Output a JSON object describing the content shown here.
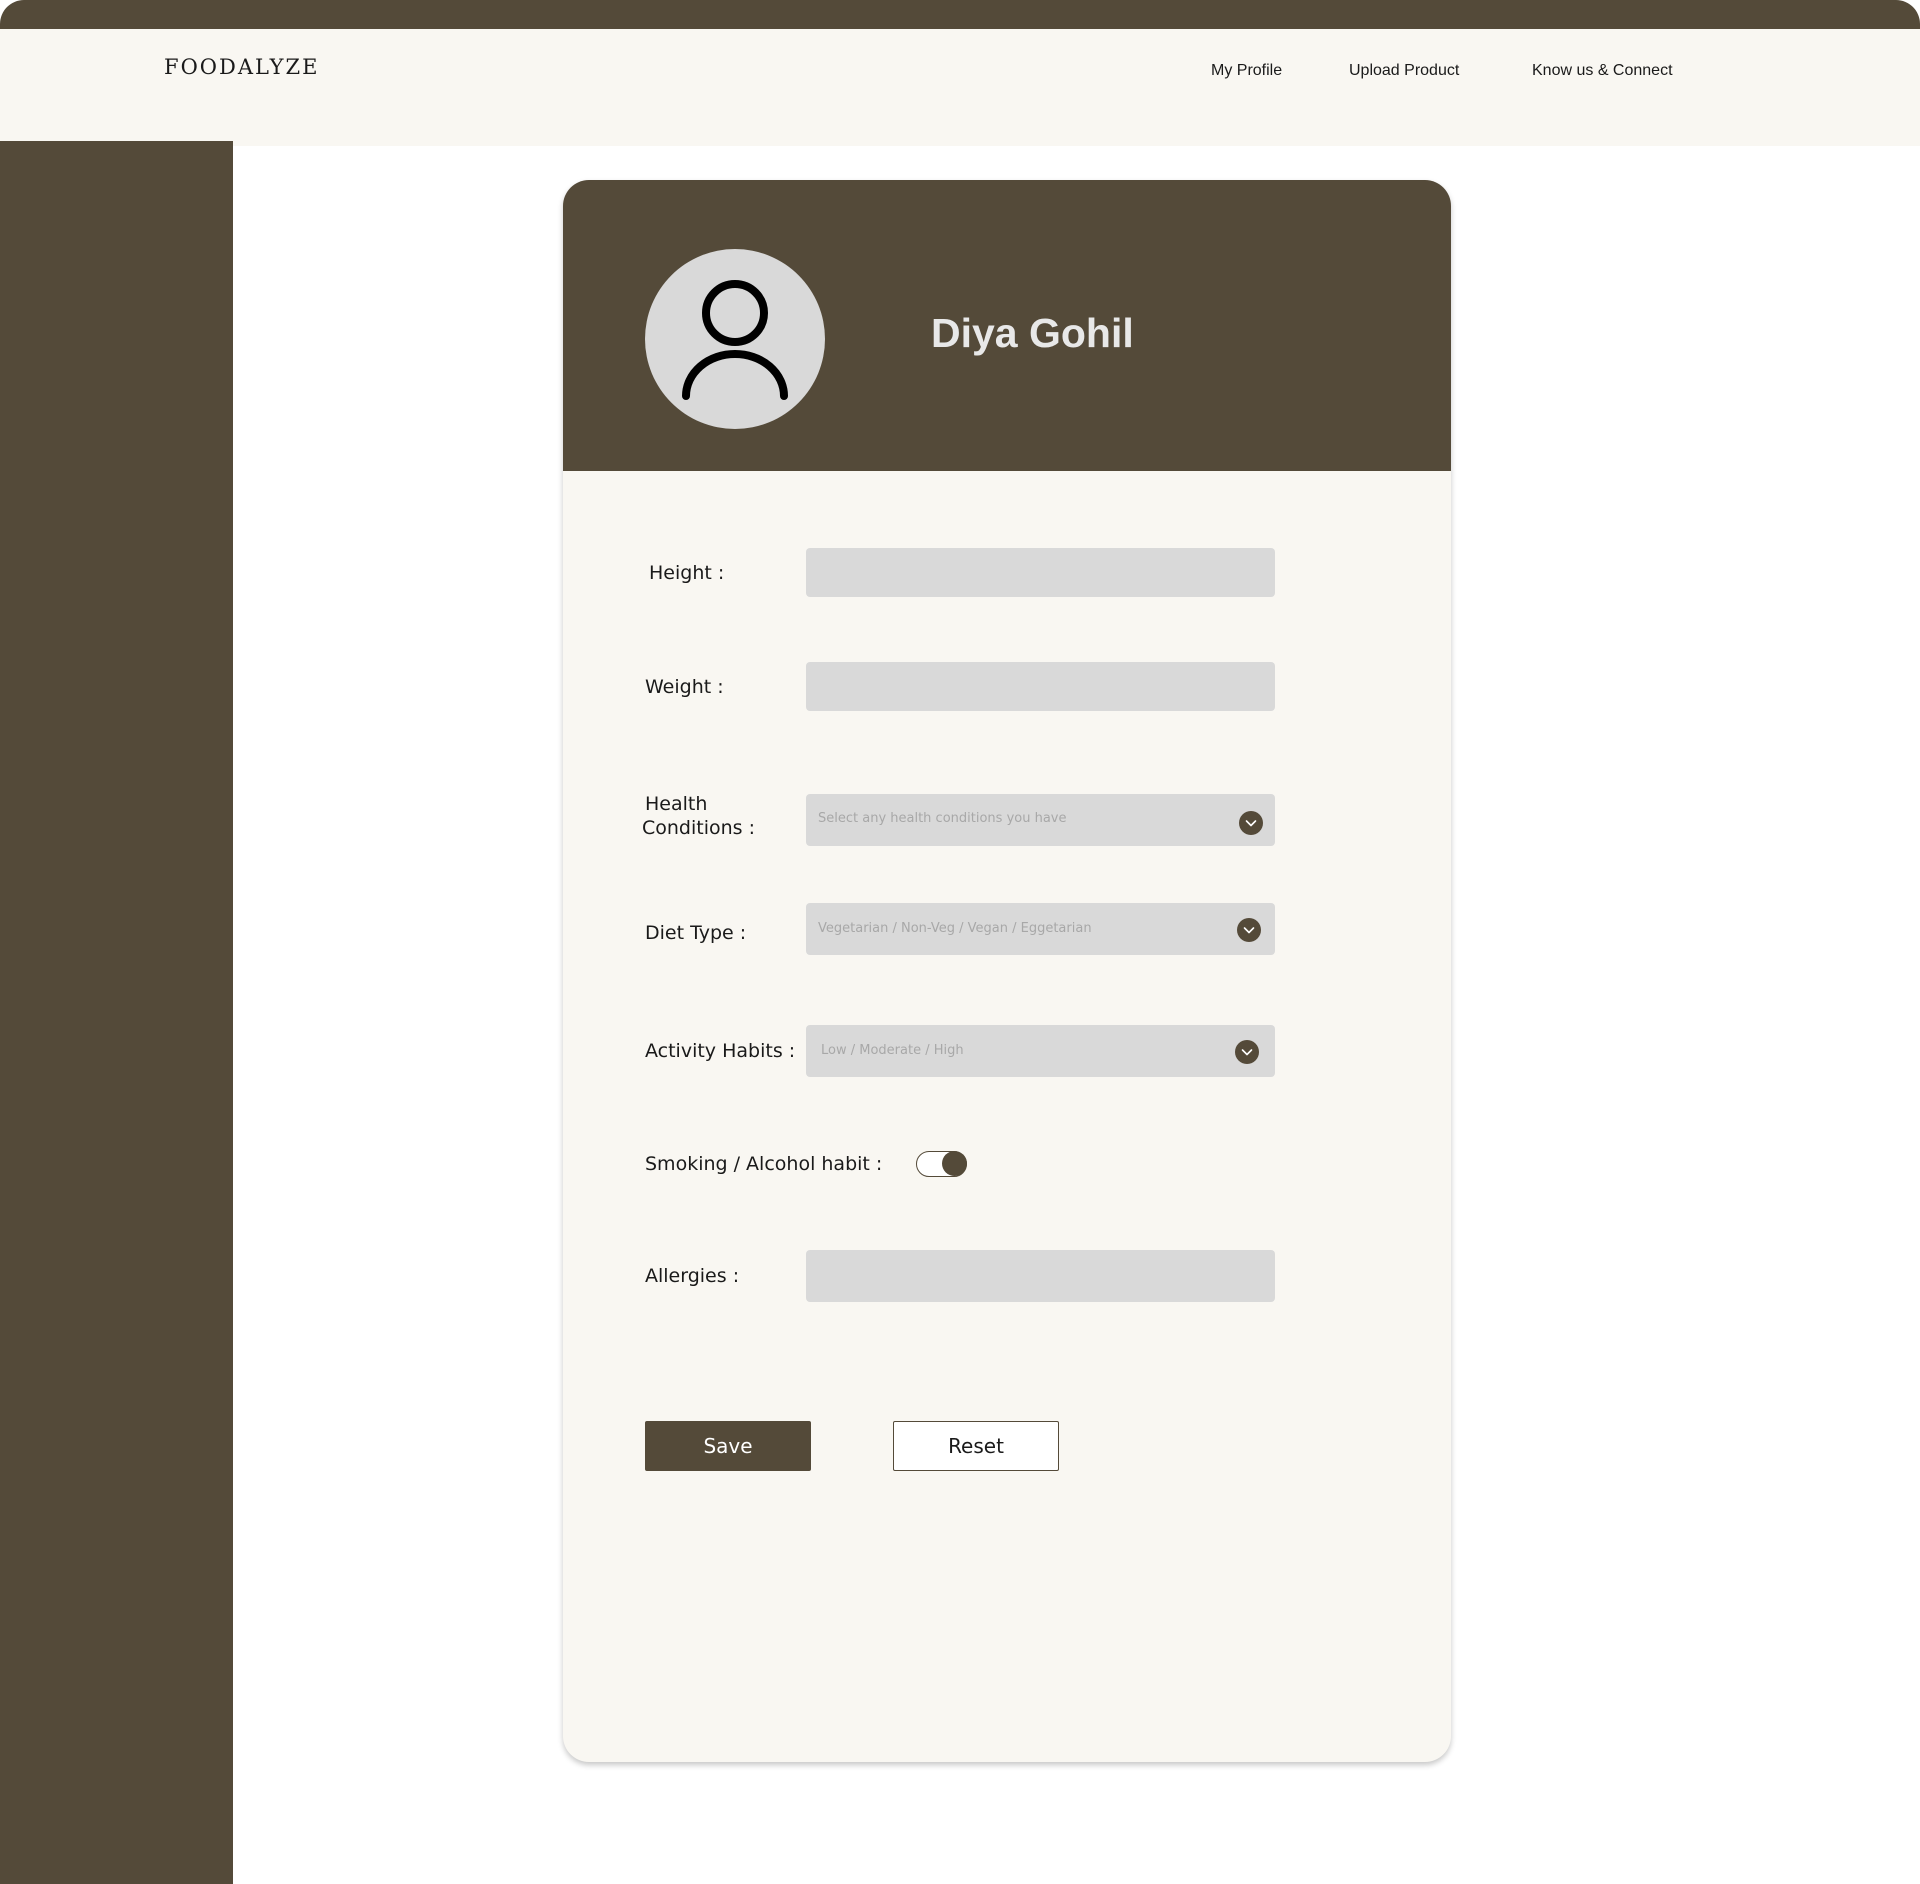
{
  "header": {
    "logo": "FOODALYZE",
    "nav": [
      "My Profile",
      "Upload Product",
      "Know us & Connect"
    ]
  },
  "profile": {
    "name": "Diya Gohil",
    "avatar_icon": "user-icon"
  },
  "form": {
    "height_label": "Height :",
    "height_value": "",
    "weight_label": "Weight :",
    "weight_value": "",
    "health_label_line1": "Health",
    "health_label_line2": "Conditions :",
    "health_placeholder": "Select any health conditions you have",
    "diet_label": "Diet Type :",
    "diet_placeholder": "Vegetarian / Non-Veg / Vegan / Eggetarian",
    "activity_label": "Activity Habits :",
    "activity_placeholder": "Low / Moderate / High",
    "smoking_label": "Smoking / Alcohol habit :",
    "smoking_toggle_on": true,
    "allergies_label": "Allergies :",
    "allergies_value": ""
  },
  "buttons": {
    "save": "Save",
    "reset": "Reset"
  },
  "colors": {
    "brand": "#544a39",
    "background": "#f9f7f2",
    "field": "#d9d9d9"
  }
}
